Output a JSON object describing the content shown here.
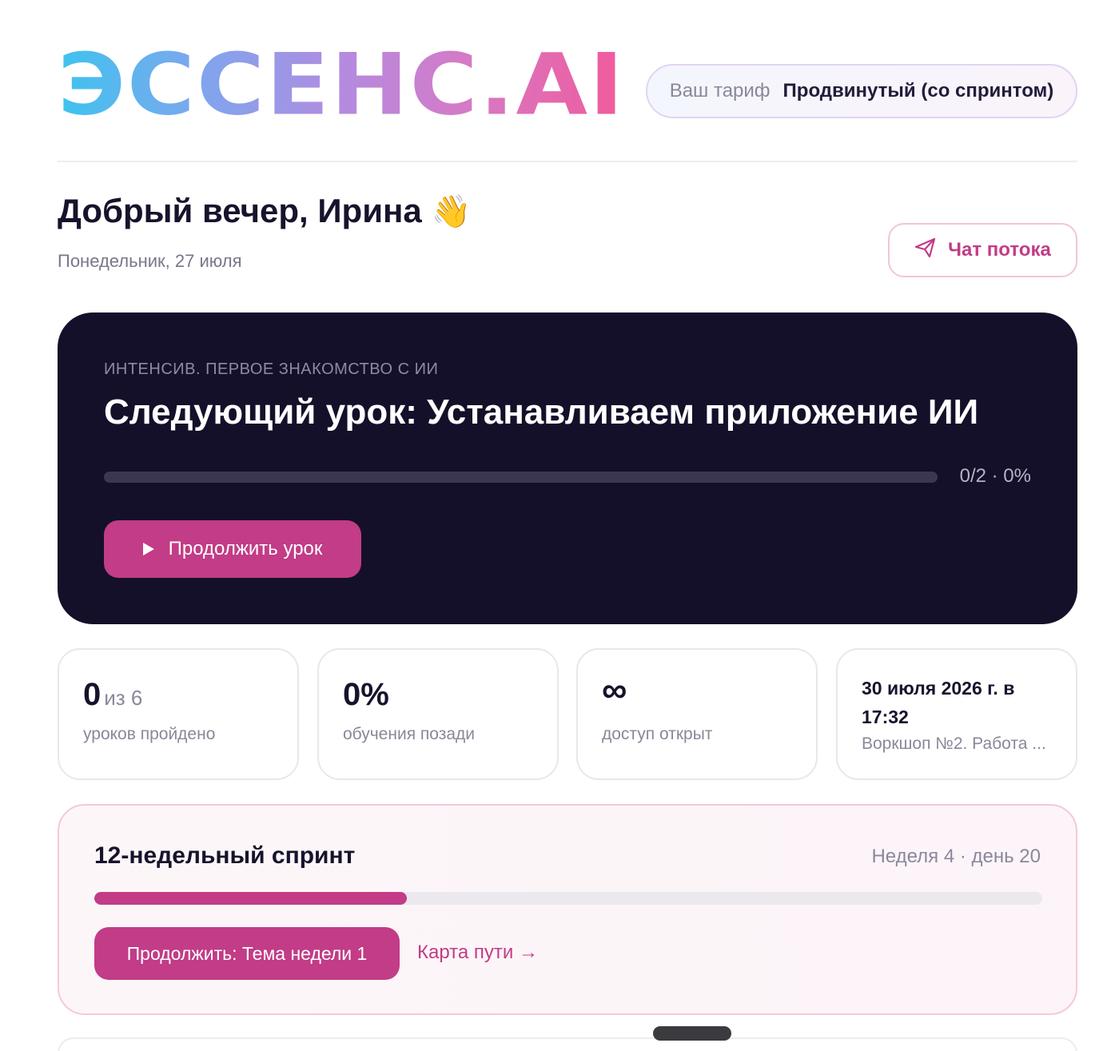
{
  "header": {
    "logo_text": "ЭССЕНС.AI",
    "plan_label": "Ваш тариф",
    "plan_value": "Продвинутый (со спринтом)"
  },
  "greeting": {
    "text": "Добрый вечер, Ирина",
    "emoji": "👋",
    "date": "Понедельник, 27 июля"
  },
  "chat_button": {
    "label": "Чат потока",
    "icon": "paper-plane-icon"
  },
  "lesson": {
    "course": "ИНТЕНСИВ. ПЕРВОЕ ЗНАКОМСТВО С ИИ",
    "title": "Следующий урок: Устанавливаем приложение ИИ",
    "progress_text": "0/2 · 0%",
    "progress_fraction": 0,
    "button_label": "Продолжить урок",
    "button_icon": "play-icon"
  },
  "stats": [
    {
      "value": "0",
      "suffix": "из 6",
      "label": "уроков пройдено"
    },
    {
      "value": "0%",
      "label": "обучения позади"
    },
    {
      "value": "∞",
      "label": "доступ открыт"
    },
    {
      "value": "30 июля 2026 г. в 17:32",
      "label": "Воркшоп №2. Работа ..."
    }
  ],
  "sprint": {
    "title": "12-недельный спринт",
    "week": "Неделя 4 · день 20",
    "progress_fraction": 0.33,
    "button_label": "Продолжить: Тема недели 1",
    "map_link": "Карта пути →"
  },
  "colors": {
    "accent": "#c23c87",
    "dark_card": "#14102a",
    "muted_text": "#8b879a"
  }
}
